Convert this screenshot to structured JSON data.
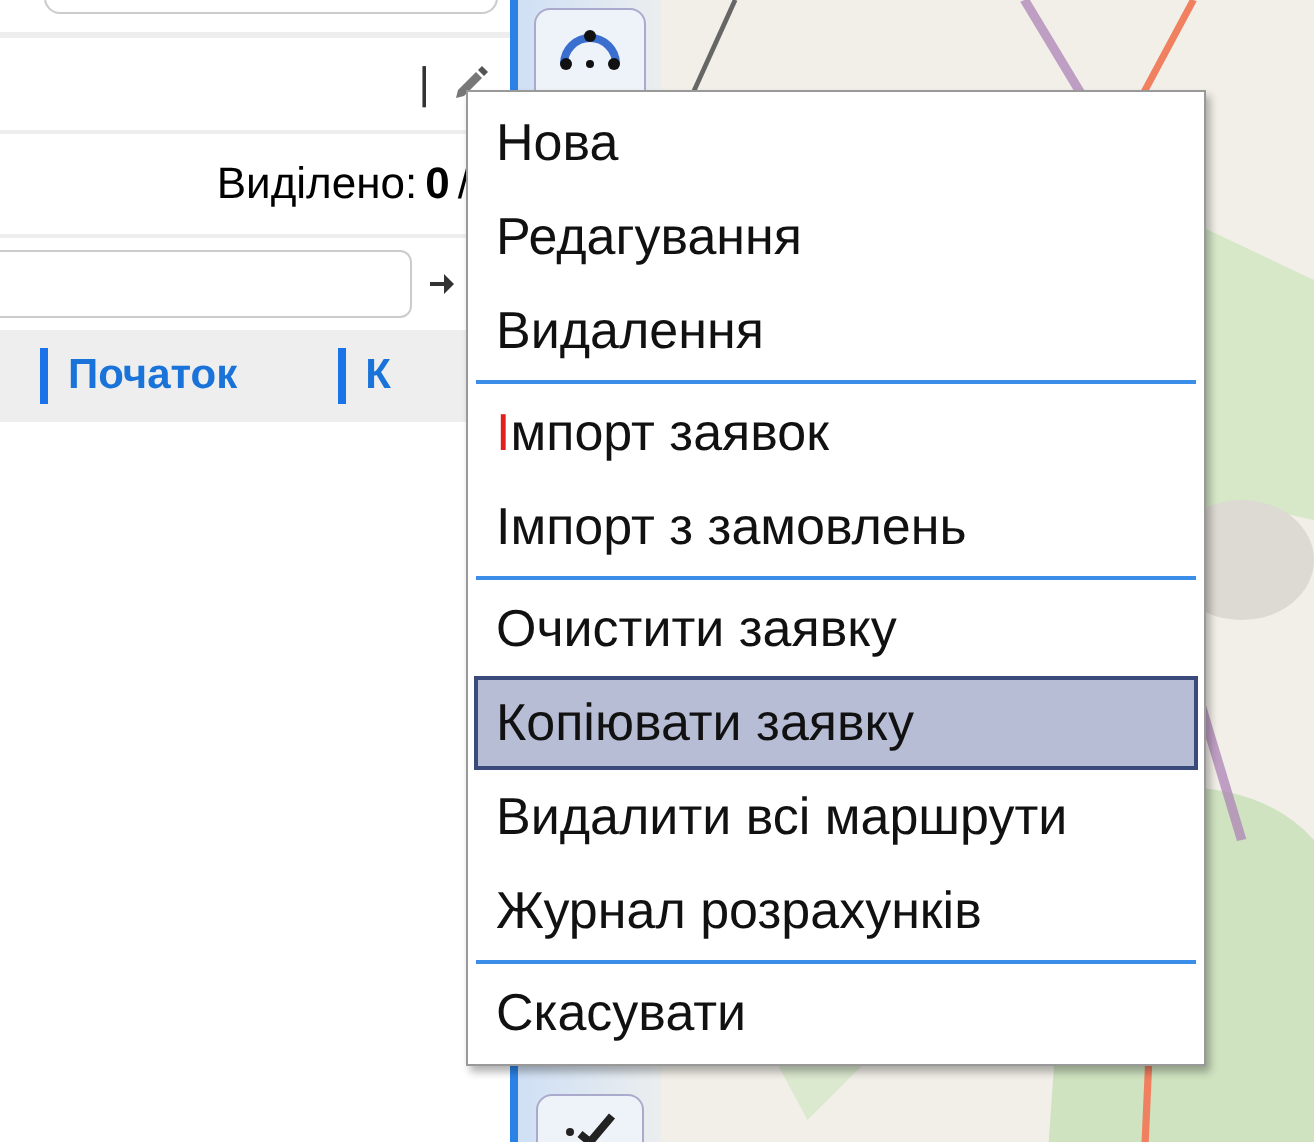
{
  "left_panel": {
    "toolbar": {
      "divider": "|"
    },
    "selection": {
      "label": "Виділено:",
      "count": "0",
      "separator": "/"
    },
    "columns": [
      "Початок",
      "К"
    ]
  },
  "context_menu": {
    "groups": [
      [
        {
          "label": "Нова",
          "selected": false,
          "first_letter_marked": false
        },
        {
          "label": "Редагування",
          "selected": false,
          "first_letter_marked": false
        },
        {
          "label": "Видалення",
          "selected": false,
          "first_letter_marked": false
        }
      ],
      [
        {
          "label": "Імпорт заявок",
          "selected": false,
          "first_letter_marked": true
        },
        {
          "label": "Імпорт з замовлень",
          "selected": false,
          "first_letter_marked": false
        }
      ],
      [
        {
          "label": "Очистити заявку",
          "selected": false,
          "first_letter_marked": false
        },
        {
          "label": "Копіювати заявку",
          "selected": true,
          "first_letter_marked": false
        },
        {
          "label": "Видалити всі маршрути",
          "selected": false,
          "first_letter_marked": false
        },
        {
          "label": "Журнал розрахунків",
          "selected": false,
          "first_letter_marked": false
        }
      ],
      [
        {
          "label": "Скасувати",
          "selected": false,
          "first_letter_marked": false
        }
      ]
    ]
  }
}
